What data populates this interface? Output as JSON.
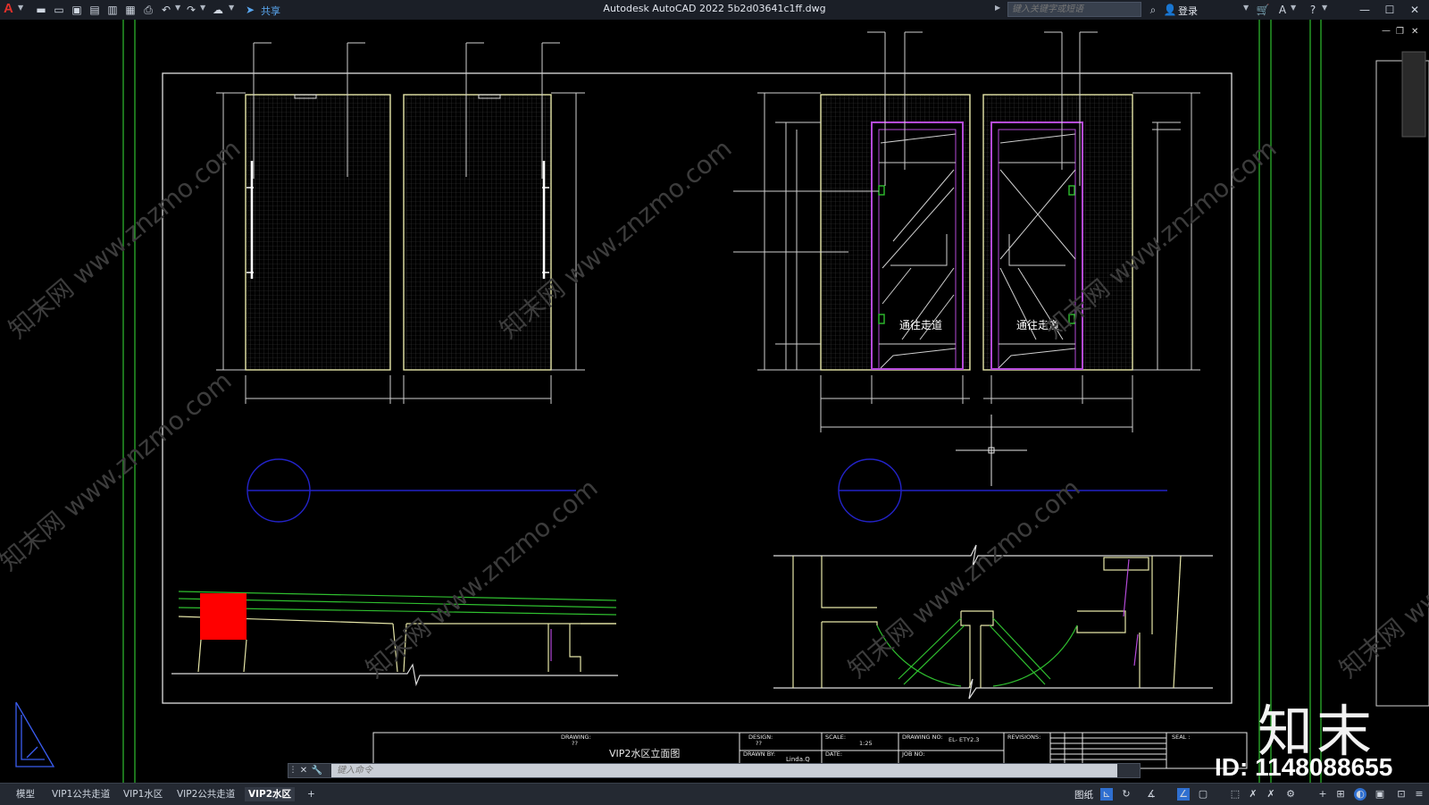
{
  "window": {
    "app_logo": "A",
    "title": "Autodesk AutoCAD 2022    5b2d03641c1ff.dwg",
    "share_label": "共享",
    "search_placeholder": "键入关键字或短语",
    "login_label": "登录"
  },
  "quick_access_icons": [
    "new-icon",
    "open-icon",
    "save-icon",
    "save-as-icon",
    "plot-preview-icon",
    "publish-icon",
    "print-icon",
    "undo-icon",
    "redo-icon",
    "workspace-icon",
    "share-icon"
  ],
  "drawing": {
    "room_label_left": "通往走道",
    "room_label_right": "通往走道",
    "watermark_text": "知末网 www.znzmo.com"
  },
  "title_block": {
    "drawing_label": "DRAWING:",
    "drawing_value": "??",
    "drawing_title": "VIP2水区立面图",
    "design_label": "DESIGN:",
    "design_value": "??",
    "drawn_by_label": "DRAWN BY:",
    "drawn_by_value": "Linda.Q",
    "scale_label": "SCALE:",
    "scale_value": "1:25",
    "date_label": "DATE:",
    "drawing_no_label": "DRAWING NO:",
    "drawing_no_value": "EL- ETY2.3",
    "job_no_label": "JOB NO:",
    "revisions_label": "REVISIONS:",
    "seal_label": "SEAL :"
  },
  "command_line": {
    "placeholder": "键入命令"
  },
  "layout_tabs": [
    {
      "label": "模型",
      "active": false
    },
    {
      "label": "VIP1公共走道",
      "active": false
    },
    {
      "label": "VIP1水区",
      "active": false
    },
    {
      "label": "VIP2公共走道",
      "active": false
    },
    {
      "label": "VIP2水区",
      "active": true
    }
  ],
  "add_tab_label": "+",
  "status": {
    "paper_label": "图纸"
  },
  "overlay": {
    "brand": "知末",
    "id_text": "ID: 1148088655"
  },
  "colors": {
    "drawing_bg": "#000000",
    "frame_white": "#e8e8e8",
    "wall_yellow": "#e6e6a8",
    "door_magenta": "#b44ad8",
    "guide_green": "#2fbf2f",
    "symbol_blue": "#2323c8",
    "fill_red": "#ff0000"
  }
}
